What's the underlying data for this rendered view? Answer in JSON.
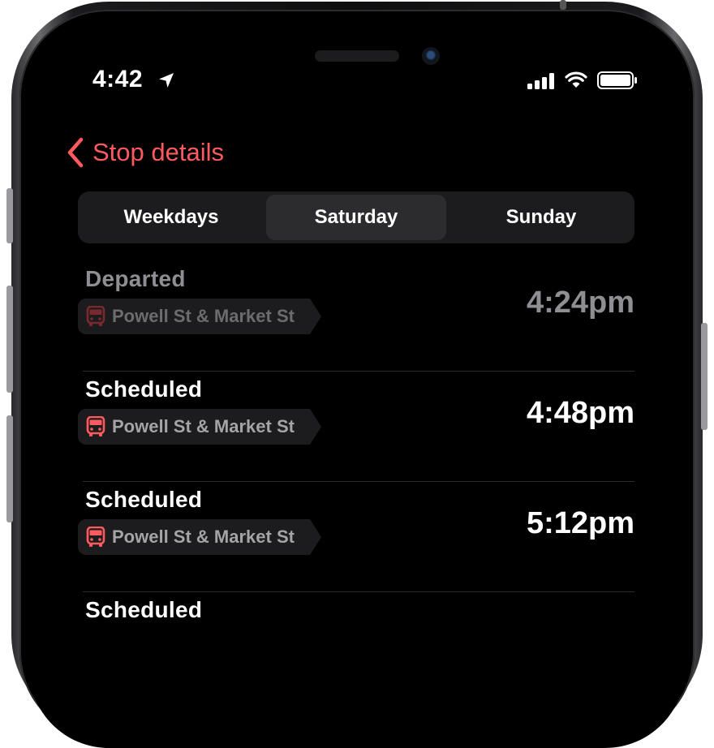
{
  "status_bar": {
    "time": "4:42"
  },
  "nav": {
    "back_label": "Stop details"
  },
  "tabs": [
    {
      "label": "Weekdays",
      "selected": false
    },
    {
      "label": "Saturday",
      "selected": true
    },
    {
      "label": "Sunday",
      "selected": false
    }
  ],
  "departures": [
    {
      "status": "Departed",
      "stop": "Powell St & Market St",
      "time": "4:24pm"
    },
    {
      "status": "Scheduled",
      "stop": "Powell St & Market St",
      "time": "4:48pm"
    },
    {
      "status": "Scheduled",
      "stop": "Powell St & Market St",
      "time": "5:12pm"
    },
    {
      "status": "Scheduled"
    }
  ],
  "colors": {
    "accent": "#ff5a5f",
    "background": "#000000",
    "segment_bg": "#1c1c1e",
    "segment_selected": "#2c2c2e",
    "muted": "#8e8e93"
  },
  "icons": {
    "back": "chevron-left-icon",
    "location": "location-arrow-icon",
    "signal": "cellular-signal-icon",
    "wifi": "wifi-icon",
    "battery": "battery-icon",
    "bus": "bus-icon"
  }
}
